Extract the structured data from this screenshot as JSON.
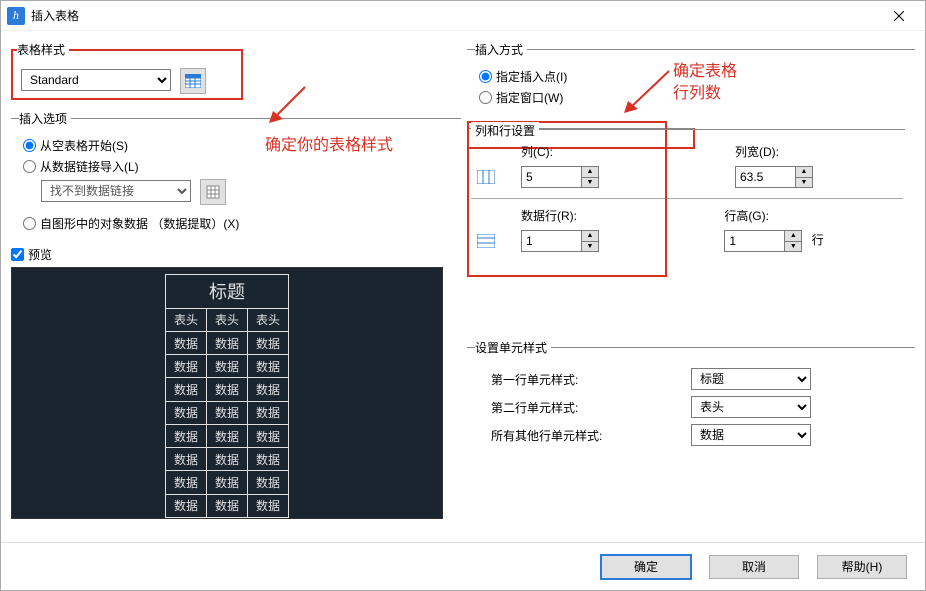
{
  "window": {
    "title": "插入表格"
  },
  "annotations": {
    "left": "确定你的表格样式",
    "right_line1": "确定表格",
    "right_line2": "行列数"
  },
  "left": {
    "style": {
      "legend": "表格样式",
      "selected": "Standard"
    },
    "insert_options": {
      "legend": "插入选项",
      "opt_empty": "从空表格开始(S)",
      "opt_datalink": "从数据链接导入(L)",
      "datalink_selected": "找不到数据链接",
      "opt_extract": "自图形中的对象数据 （数据提取）(X)"
    },
    "preview": {
      "label": "预览",
      "title_cell": "标题",
      "header_cell": "表头",
      "data_cell": "数据"
    }
  },
  "right": {
    "insert_method": {
      "legend": "插入方式",
      "opt_point": "指定插入点(I)",
      "opt_window": "指定窗口(W)"
    },
    "colrow": {
      "legend": "列和行设置",
      "cols_label": "列(C):",
      "cols_value": "5",
      "colwidth_label": "列宽(D):",
      "colwidth_value": "63.5",
      "rows_label": "数据行(R):",
      "rows_value": "1",
      "rowheight_label": "行高(G):",
      "rowheight_value": "1",
      "rowheight_unit": "行"
    },
    "cellstyle": {
      "legend": "设置单元样式",
      "row1_label": "第一行单元样式:",
      "row1_value": "标题",
      "row2_label": "第二行单元样式:",
      "row2_value": "表头",
      "other_label": "所有其他行单元样式:",
      "other_value": "数据"
    }
  },
  "footer": {
    "ok": "确定",
    "cancel": "取消",
    "help": "帮助(H)"
  }
}
